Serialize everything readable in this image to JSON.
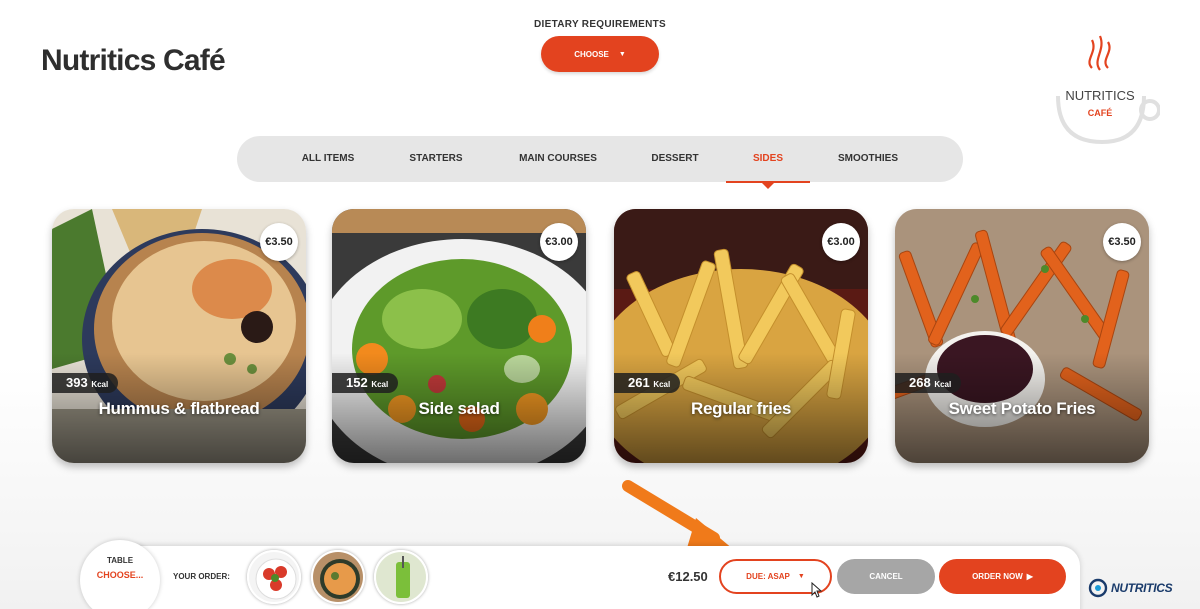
{
  "header": {
    "title": "Nutritics Café",
    "dietary_label": "DIETARY REQUIREMENTS",
    "dietary_value": "CHOOSE",
    "dietary_caret": "▼"
  },
  "logo": {
    "line1": "NUTRITICS",
    "line2": "CAFÉ"
  },
  "tabs": [
    {
      "label": "ALL ITEMS",
      "active": false
    },
    {
      "label": "STARTERS",
      "active": false
    },
    {
      "label": "MAIN COURSES",
      "active": false
    },
    {
      "label": "DESSERT",
      "active": false
    },
    {
      "label": "SIDES",
      "active": true
    },
    {
      "label": "SMOOTHIES",
      "active": false
    }
  ],
  "items": [
    {
      "name": "Hummus & flatbread",
      "price": "€3.50",
      "kcal": "393",
      "kcal_unit": "Kcal"
    },
    {
      "name": "Side salad",
      "price": "€3.00",
      "kcal": "152",
      "kcal_unit": "Kcal"
    },
    {
      "name": "Regular fries",
      "price": "€3.00",
      "kcal": "261",
      "kcal_unit": "Kcal"
    },
    {
      "name": "Sweet Potato Fries",
      "price": "€3.50",
      "kcal": "268",
      "kcal_unit": "Kcal"
    }
  ],
  "order_bar": {
    "table_label": "TABLE",
    "table_value": "CHOOSE...",
    "your_order_label": "YOUR ORDER:",
    "total": "€12.50",
    "due_label": "DUE: ASAP",
    "due_caret": "▼",
    "cancel_label": "CANCEL",
    "order_label": "ORDER NOW",
    "order_arrow": "▶"
  },
  "footer_brand": "NUTRITICS",
  "colors": {
    "accent": "#e3431f",
    "tab_bg": "#e6e6e6",
    "cancel": "#a6a6a6",
    "annotation_arrow": "#f07a1a"
  }
}
